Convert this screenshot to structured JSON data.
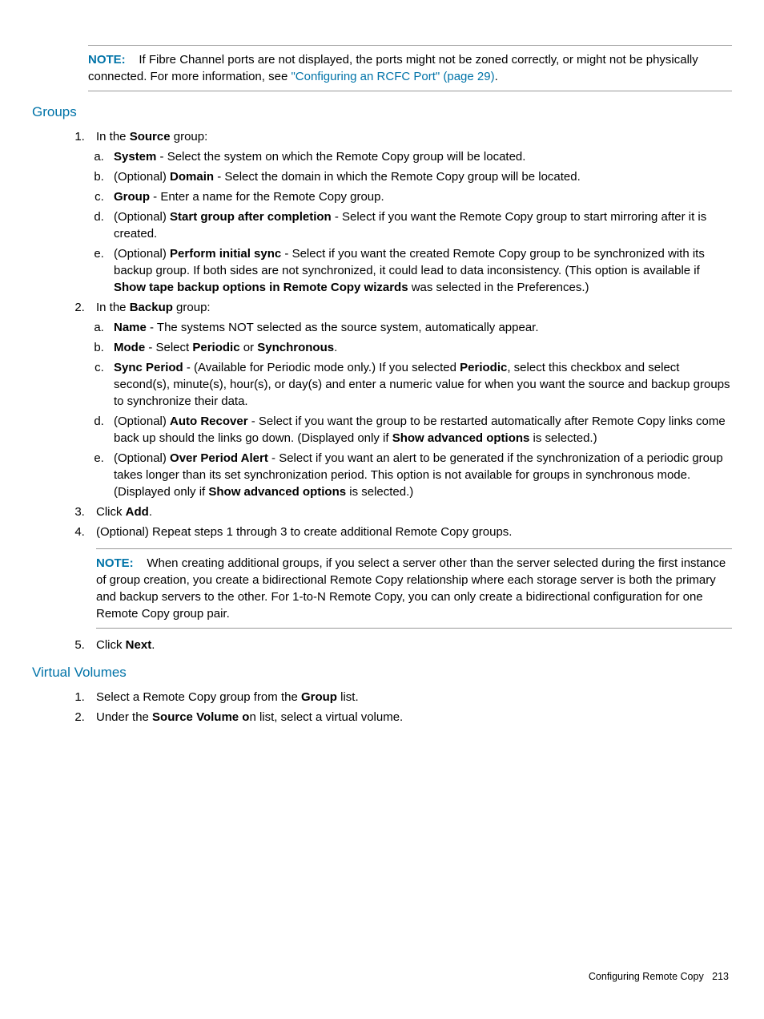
{
  "topNote": {
    "label": "NOTE:",
    "text_before": "If Fibre Channel ports are not displayed, the ports might not be zoned correctly, or might not be physically connected. For more information, see ",
    "link": "\"Configuring an RCFC Port\" (page 29)",
    "text_after": "."
  },
  "groups": {
    "heading": "Groups",
    "step1_intro_a": "In the ",
    "step1_intro_b": "Source",
    "step1_intro_c": " group:",
    "s1a_b": "System",
    "s1a_t": " - Select the system on which the Remote Copy group will be located.",
    "s1b_p": "(Optional) ",
    "s1b_b": "Domain",
    "s1b_t": " - Select the domain in which the Remote Copy group will be located.",
    "s1c_b": "Group",
    "s1c_t": " - Enter a name for the Remote Copy group.",
    "s1d_p": "(Optional) ",
    "s1d_b": "Start group after completion",
    "s1d_t": " - Select if you want the Remote Copy group to start mirroring after it is created.",
    "s1e_p": "(Optional) ",
    "s1e_b": "Perform initial sync",
    "s1e_t1": " - Select if you want the created Remote Copy group to be synchronized with its backup group. If both sides are not synchronized, it could lead to data inconsistency. (This option is available if ",
    "s1e_b2": "Show tape backup options in Remote Copy wizards",
    "s1e_t2": " was selected in the Preferences.)",
    "step2_intro_a": "In the ",
    "step2_intro_b": "Backup",
    "step2_intro_c": " group:",
    "s2a_b": "Name",
    "s2a_t": " - The systems NOT selected as the source system, automatically appear.",
    "s2b_b": "Mode",
    "s2b_t1": " - Select ",
    "s2b_b2": "Periodic",
    "s2b_t2": " or ",
    "s2b_b3": "Synchronous",
    "s2b_t3": ".",
    "s2c_b": "Sync Period",
    "s2c_t1": " - (Available for Periodic mode only.) If you selected ",
    "s2c_b2": "Periodic",
    "s2c_t2": ", select this checkbox and select second(s), minute(s), hour(s), or day(s) and enter a numeric value for when you want the source and backup groups to synchronize their data.",
    "s2d_p": "(Optional) ",
    "s2d_b": "Auto Recover",
    "s2d_t1": " - Select if you want the group to be restarted automatically after Remote Copy links come back up should the links go down. (Displayed only if ",
    "s2d_b2": "Show advanced options",
    "s2d_t2": " is selected.)",
    "s2e_p": "(Optional) ",
    "s2e_b": "Over Period Alert",
    "s2e_t1": " - Select if you want an alert to be generated if the synchronization of a periodic group takes longer than its set synchronization period. This option is not available for groups in synchronous mode. (Displayed only if ",
    "s2e_b2": "Show advanced options",
    "s2e_t2": " is selected.)",
    "step3_a": "Click ",
    "step3_b": "Add",
    "step3_c": ".",
    "step4": "(Optional) Repeat steps 1 through 3 to create additional Remote Copy groups.",
    "note2_label": "NOTE:",
    "note2_text": "When creating additional groups, if you select a server other than the server selected during the first instance of group creation, you create a bidirectional Remote Copy relationship where each storage server is both the primary and backup servers to the other. For 1-to-N Remote Copy, you can only create a bidirectional configuration for one Remote Copy group pair.",
    "step5_a": "Click ",
    "step5_b": "Next",
    "step5_c": "."
  },
  "vv": {
    "heading": "Virtual Volumes",
    "s1_a": "Select a Remote Copy group from the ",
    "s1_b": "Group",
    "s1_c": " list.",
    "s2_a": "Under the ",
    "s2_b": "Source Volume o",
    "s2_c": "n list, select a virtual volume."
  },
  "footer": {
    "text": "Configuring Remote Copy",
    "page": "213"
  }
}
